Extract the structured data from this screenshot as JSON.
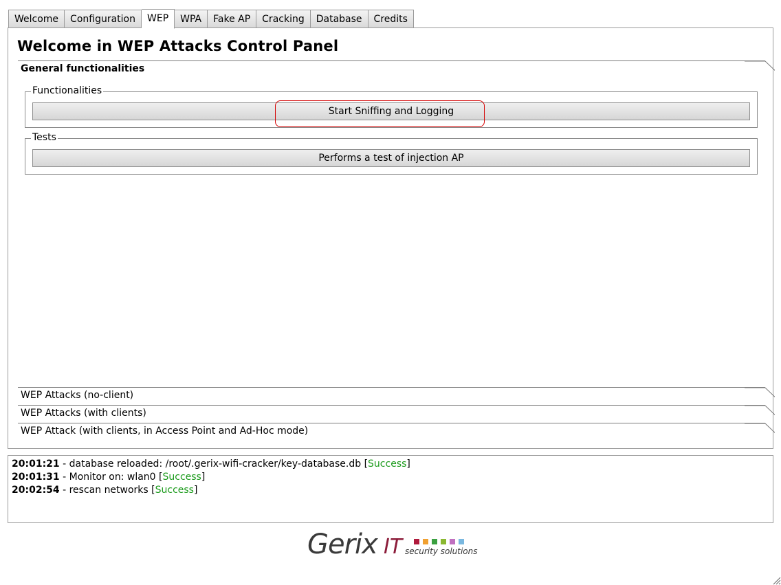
{
  "tabs": [
    {
      "label": "Welcome",
      "active": false
    },
    {
      "label": "Configuration",
      "active": false
    },
    {
      "label": "WEP",
      "active": true
    },
    {
      "label": "WPA",
      "active": false
    },
    {
      "label": "Fake AP",
      "active": false
    },
    {
      "label": "Cracking",
      "active": false
    },
    {
      "label": "Database",
      "active": false
    },
    {
      "label": "Credits",
      "active": false
    }
  ],
  "main": {
    "title": "Welcome in WEP Attacks Control Panel",
    "general_section": "General functionalities",
    "functionalities_group": "Functionalities",
    "sniff_button": "Start Sniffing and Logging",
    "tests_group": "Tests",
    "injection_button": "Performs a test of injection AP",
    "collapsed_sections": [
      "WEP Attacks (no-client)",
      "WEP Attacks (with clients)",
      "WEP Attack (with clients, in Access Point and Ad-Hoc mode)"
    ]
  },
  "log": [
    {
      "time": "20:01:21",
      "message": " - database reloaded: /root/.gerix-wifi-cracker/key-database.db [",
      "status": "Success",
      "close": "]"
    },
    {
      "time": "20:01:31",
      "message": " - Monitor on: wlan0 [",
      "status": "Success",
      "close": "]"
    },
    {
      "time": "20:02:54",
      "message": " - rescan networks [",
      "status": "Success",
      "close": "]"
    }
  ],
  "logo": {
    "name": "Gerix",
    "suffix": "IT",
    "tagline": "security solutions",
    "square_colors": [
      "#b01a3c",
      "#f0a030",
      "#3aa040",
      "#8ab830",
      "#c070c0",
      "#7ab8e0"
    ]
  },
  "colors": {
    "success": "#1a9a1a",
    "highlight": "#d40000"
  }
}
